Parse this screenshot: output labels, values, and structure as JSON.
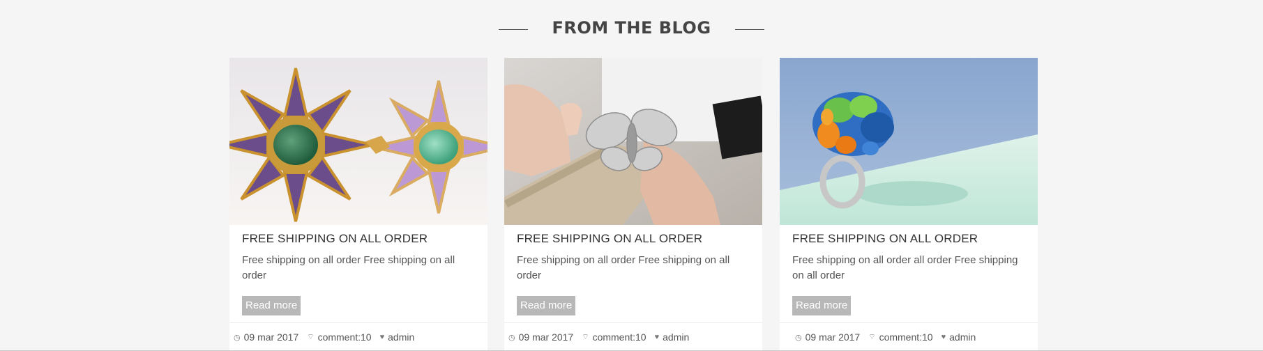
{
  "section": {
    "title": "FROM THE BLOG"
  },
  "posts": [
    {
      "image_icon": "bracelet-photo",
      "title": "FREE SHIPPING ON ALL ORDER",
      "excerpt": "Free shipping on all order Free shipping on all order",
      "read_more": "Read more",
      "date": "09 mar 2017",
      "comments": "comment:10",
      "author": "admin"
    },
    {
      "image_icon": "jeweler-crafting-photo",
      "title": "FREE SHIPPING ON ALL ORDER",
      "excerpt": "Free shipping on all order Free shipping on all order",
      "read_more": "Read more",
      "date": "09 mar 2017",
      "comments": "comment:10",
      "author": "admin"
    },
    {
      "image_icon": "gemstone-ring-photo",
      "title": "FREE SHIPPING ON ALL ORDER",
      "excerpt": "Free shipping on all order all order Free shipping on all order",
      "read_more": "Read more",
      "date": "09 mar 2017",
      "comments": "comment:10",
      "author": "admin"
    }
  ],
  "colors": {
    "background": "#f5f5f5",
    "card": "#ffffff",
    "button": "#b8b8b8",
    "heading": "#444444"
  }
}
